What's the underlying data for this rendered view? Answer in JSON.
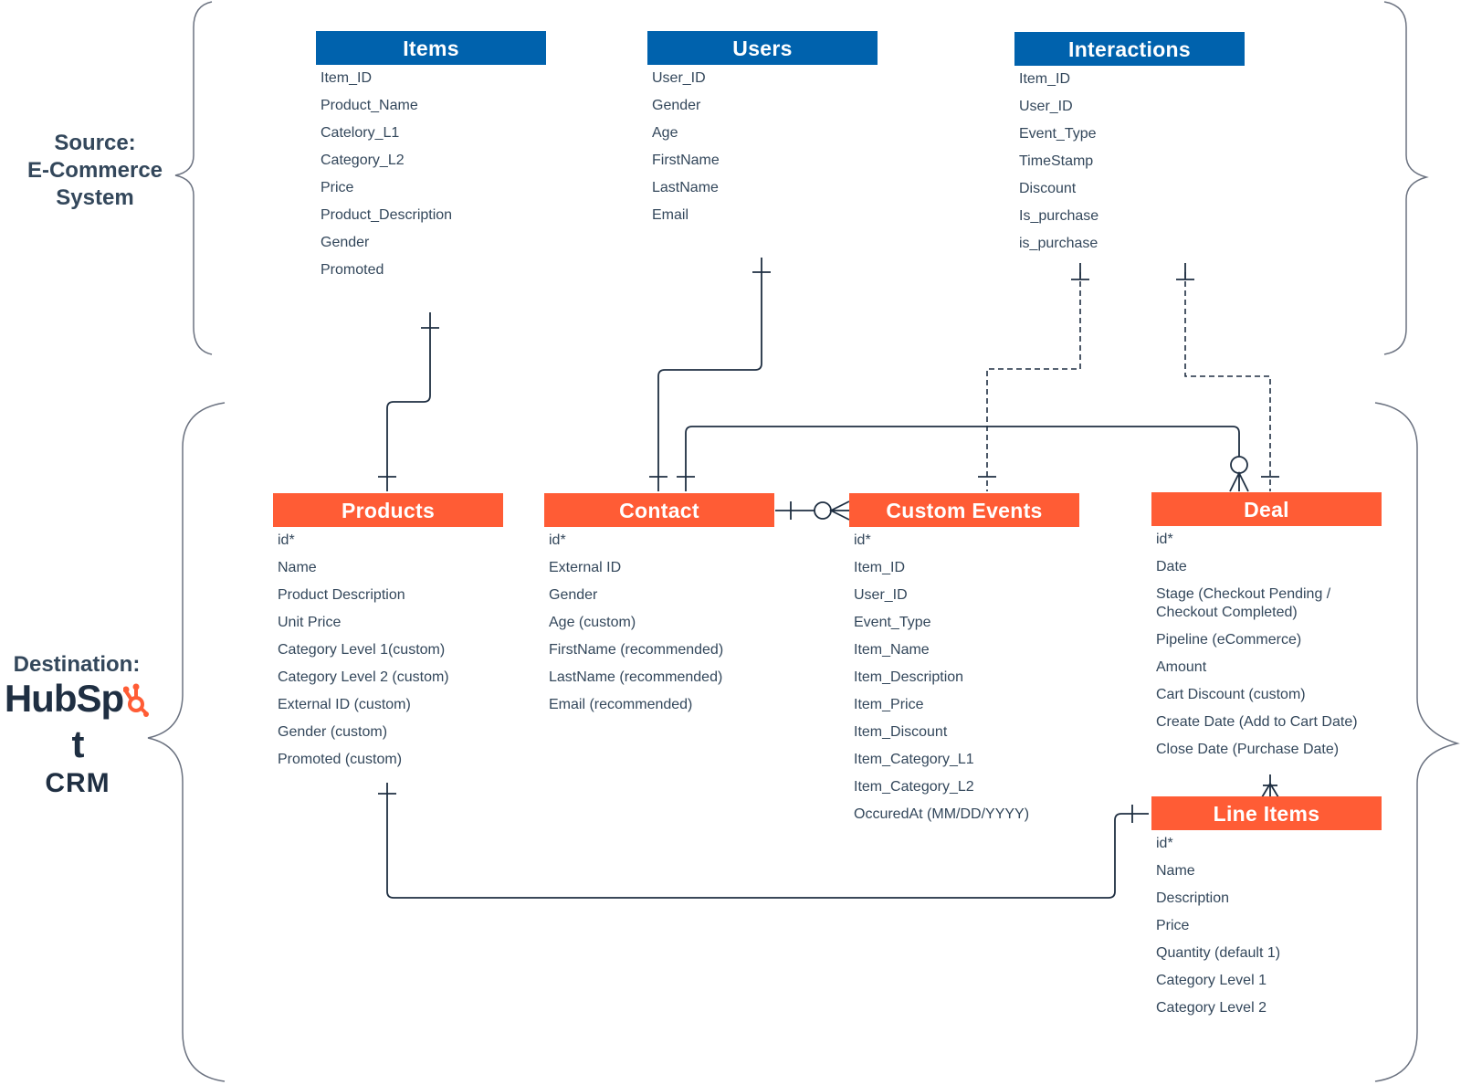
{
  "sections": {
    "source_label": "Source:\nE-Commerce\nSystem",
    "source_lines": [
      "Source:",
      "E-Commerce",
      "System"
    ],
    "destination_label": "Destination:",
    "destination_brand": "HubSpot",
    "destination_brand_parts": [
      "HubSp",
      "t"
    ],
    "destination_product": "CRM"
  },
  "colors": {
    "source_header": "#0062ad",
    "destination_header": "#ff5c35",
    "line": "#1f2f42",
    "brace": "#6b7280",
    "text": "#33475b"
  },
  "source_entities": {
    "items": {
      "title": "Items",
      "fields": [
        "Item_ID",
        "Product_Name",
        "Catelory_L1",
        "Category_L2",
        "Price",
        "Product_Description",
        "Gender",
        "Promoted"
      ]
    },
    "users": {
      "title": "Users",
      "fields": [
        "User_ID",
        "Gender",
        "Age",
        "FirstName",
        "LastName",
        "Email"
      ]
    },
    "interactions": {
      "title": "Interactions",
      "fields": [
        "Item_ID",
        "User_ID",
        "Event_Type",
        "TimeStamp",
        "Discount",
        "Is_purchase",
        "is_purchase"
      ]
    }
  },
  "destination_entities": {
    "products": {
      "title": "Products",
      "fields": [
        "id*",
        "Name",
        "Product Description",
        "Unit Price",
        "Category Level 1(custom)",
        "Category Level 2 (custom)",
        "External ID (custom)",
        "Gender (custom)",
        "Promoted (custom)"
      ]
    },
    "contact": {
      "title": "Contact",
      "fields": [
        "id*",
        "External ID",
        "Gender",
        "Age (custom)",
        "FirstName (recommended)",
        "LastName (recommended)",
        "Email (recommended)"
      ]
    },
    "custom_events": {
      "title": "Custom Events",
      "fields": [
        "id*",
        "Item_ID",
        "User_ID",
        "Event_Type",
        "Item_Name",
        "Item_Description",
        "Item_Price",
        "Item_Discount",
        "Item_Category_L1",
        "Item_Category_L2",
        "OccuredAt (MM/DD/YYYY)"
      ]
    },
    "deal": {
      "title": "Deal",
      "fields": [
        "id*",
        "Date",
        "Stage (Checkout Pending /\nCheckout Completed)",
        "Pipeline (eCommerce)",
        "Amount",
        "Cart Discount (custom)",
        "Create Date (Add to Cart Date)",
        "Close Date (Purchase Date)"
      ]
    },
    "line_items": {
      "title": "Line Items",
      "fields": [
        "id*",
        "Name",
        "Description",
        "Price",
        "Quantity (default 1)",
        "Category Level 1",
        "Category Level 2"
      ]
    }
  },
  "relationships": [
    {
      "from": "Items",
      "to": "Products",
      "from_end": "one",
      "to_end": "one",
      "style": "solid"
    },
    {
      "from": "Users",
      "to": "Contact",
      "from_end": "one",
      "to_end": "one",
      "style": "solid"
    },
    {
      "from": "Interactions",
      "to": "Custom Events",
      "from_end": "one",
      "to_end": "one",
      "style": "dashed"
    },
    {
      "from": "Interactions",
      "to": "Deal",
      "from_end": "one",
      "to_end": "one",
      "style": "dashed"
    },
    {
      "from": "Contact",
      "to": "Custom Events",
      "from_end": "one",
      "to_end": "zero-or-many",
      "style": "solid"
    },
    {
      "from": "Contact",
      "to": "Deal",
      "from_end": "one",
      "to_end": "zero-or-many",
      "style": "solid"
    },
    {
      "from": "Deal",
      "to": "Line Items",
      "from_end": "many",
      "to_end": "one",
      "style": "solid"
    },
    {
      "from": "Products",
      "to": "Line Items",
      "from_end": "one",
      "to_end": "one",
      "style": "solid"
    }
  ]
}
